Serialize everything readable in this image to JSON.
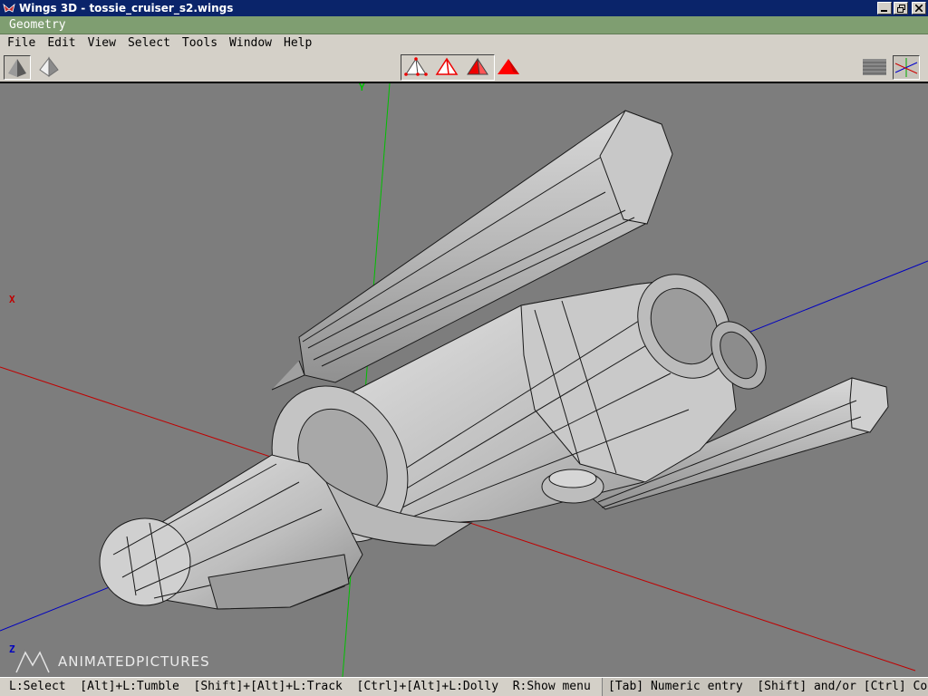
{
  "window": {
    "title": "Wings 3D - tossie_cruiser_s2.wings",
    "icon": "wings-logo-icon"
  },
  "geometry_bar": {
    "label": "Geometry"
  },
  "menu": {
    "items": [
      "File",
      "Edit",
      "View",
      "Select",
      "Tools",
      "Window",
      "Help"
    ]
  },
  "toolbar": {
    "left_icons": [
      "smooth-shading-icon",
      "wireframe-shading-icon"
    ],
    "selection_modes": [
      "vertex-select-icon",
      "edge-select-icon",
      "face-select-icon",
      "body-select-icon"
    ],
    "right_icons": [
      "groundplane-icon",
      "axes-icon"
    ]
  },
  "viewport": {
    "axis_labels": {
      "y": "Y",
      "x": "X",
      "z": "Z"
    },
    "colors": {
      "background": "#7d7d7d",
      "x_axis": "#c00000",
      "y_axis": "#00c000",
      "z_axis": "#0000c0"
    }
  },
  "watermark": {
    "text": "ANIMATEDPICTURES"
  },
  "status": {
    "left": "L:Select  [Alt]+L:Tumble  [Shift]+[Alt]+L:Track  [Ctrl]+[Alt]+L:Dolly  R:Show menu",
    "right": "[Tab] Numeric entry  [Shift] and/or [Ctrl] Constrain"
  }
}
